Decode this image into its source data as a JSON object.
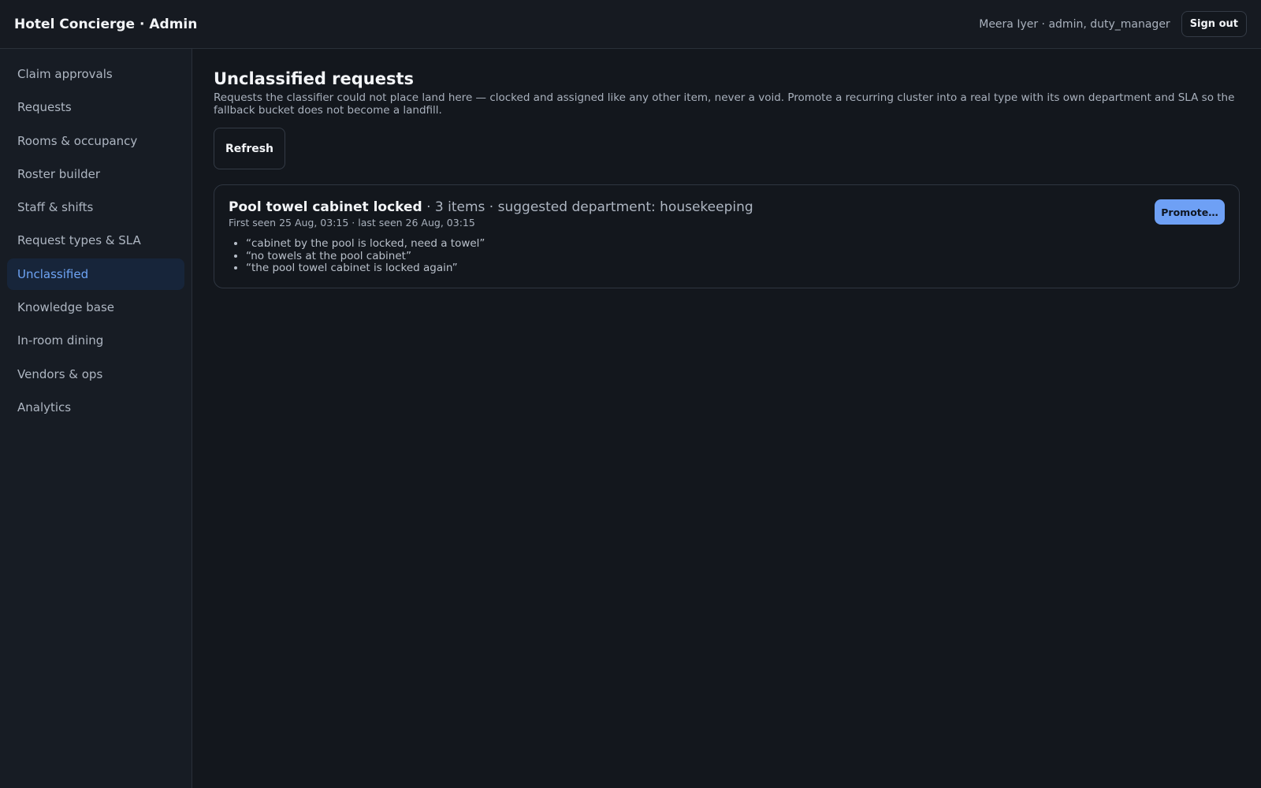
{
  "header": {
    "title": "Hotel Concierge · Admin",
    "user": "Meera Iyer · admin, duty_manager",
    "signout_label": "Sign out"
  },
  "sidebar": {
    "items": [
      {
        "label": "Claim approvals"
      },
      {
        "label": "Requests"
      },
      {
        "label": "Rooms & occupancy"
      },
      {
        "label": "Roster builder"
      },
      {
        "label": "Staff & shifts"
      },
      {
        "label": "Request types & SLA"
      },
      {
        "label": "Unclassified",
        "active": true
      },
      {
        "label": "Knowledge base"
      },
      {
        "label": "In-room dining"
      },
      {
        "label": "Vendors & ops"
      },
      {
        "label": "Analytics"
      }
    ]
  },
  "main": {
    "title": "Unclassified requests",
    "description": "Requests the classifier could not place land here — clocked and assigned like any other item, never a void. Promote a recurring cluster into a real type with its own department and SLA so the fallback bucket does not become a landfill.",
    "refresh_label": "Refresh",
    "clusters": [
      {
        "name": "Pool towel cabinet locked",
        "meta": " · 3 items · suggested department: housekeeping",
        "seen": "First seen 25 Aug, 03:15 · last seen 26 Aug, 03:15",
        "examples": [
          "“cabinet by the pool is locked, need a towel”",
          "“no towels at the pool cabinet”",
          "“the pool towel cabinet is locked again”"
        ],
        "promote_label": "Promote…"
      }
    ]
  },
  "colors": {
    "accent": "#6ea0f5",
    "active_nav_bg": "#17253a",
    "background": "#13171d"
  }
}
